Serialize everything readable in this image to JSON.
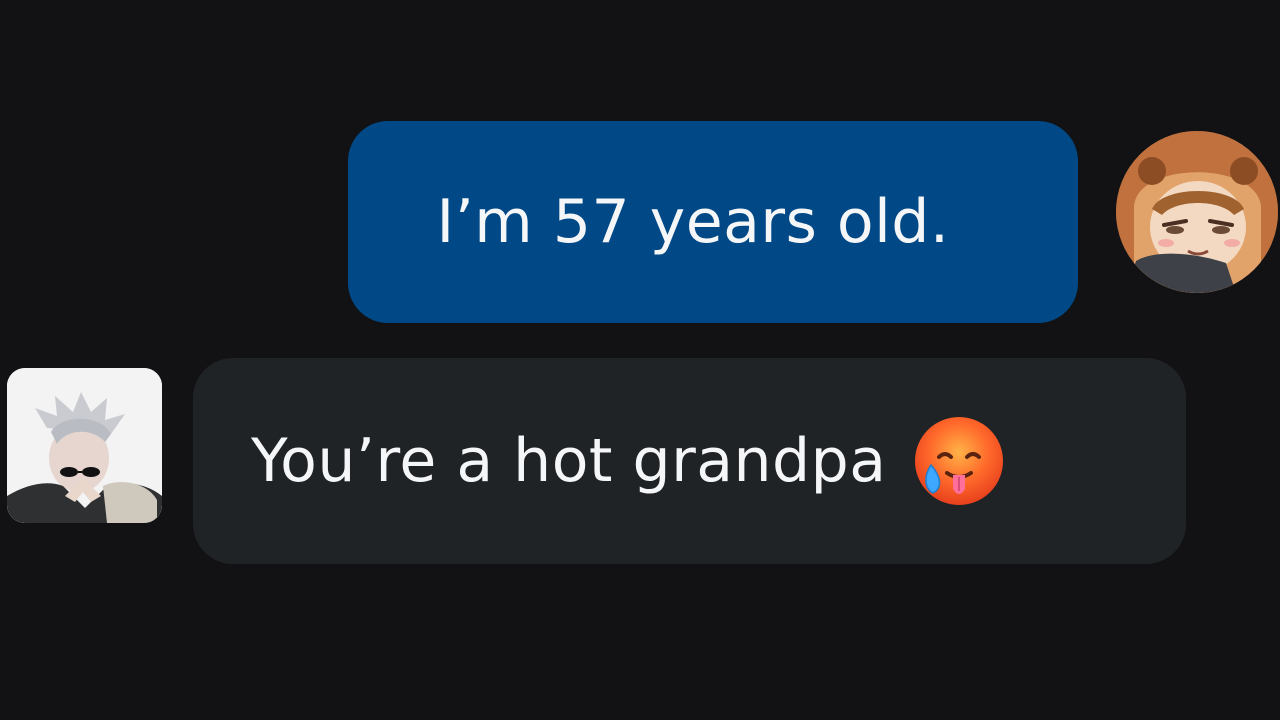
{
  "chat": {
    "messages": [
      {
        "direction": "outgoing",
        "text": "I’m 57 years old.",
        "avatar": "anime-girl-hood-avatar-icon"
      },
      {
        "direction": "incoming",
        "text": "You’re a hot grandpa",
        "emoji": "hot-face-emoji-icon",
        "avatar": "white-haired-character-avatar-icon"
      }
    ]
  },
  "colors": {
    "background": "#121214",
    "outgoing_bubble": "#014886",
    "incoming_bubble": "#202326",
    "text": "#f4f6f8"
  }
}
